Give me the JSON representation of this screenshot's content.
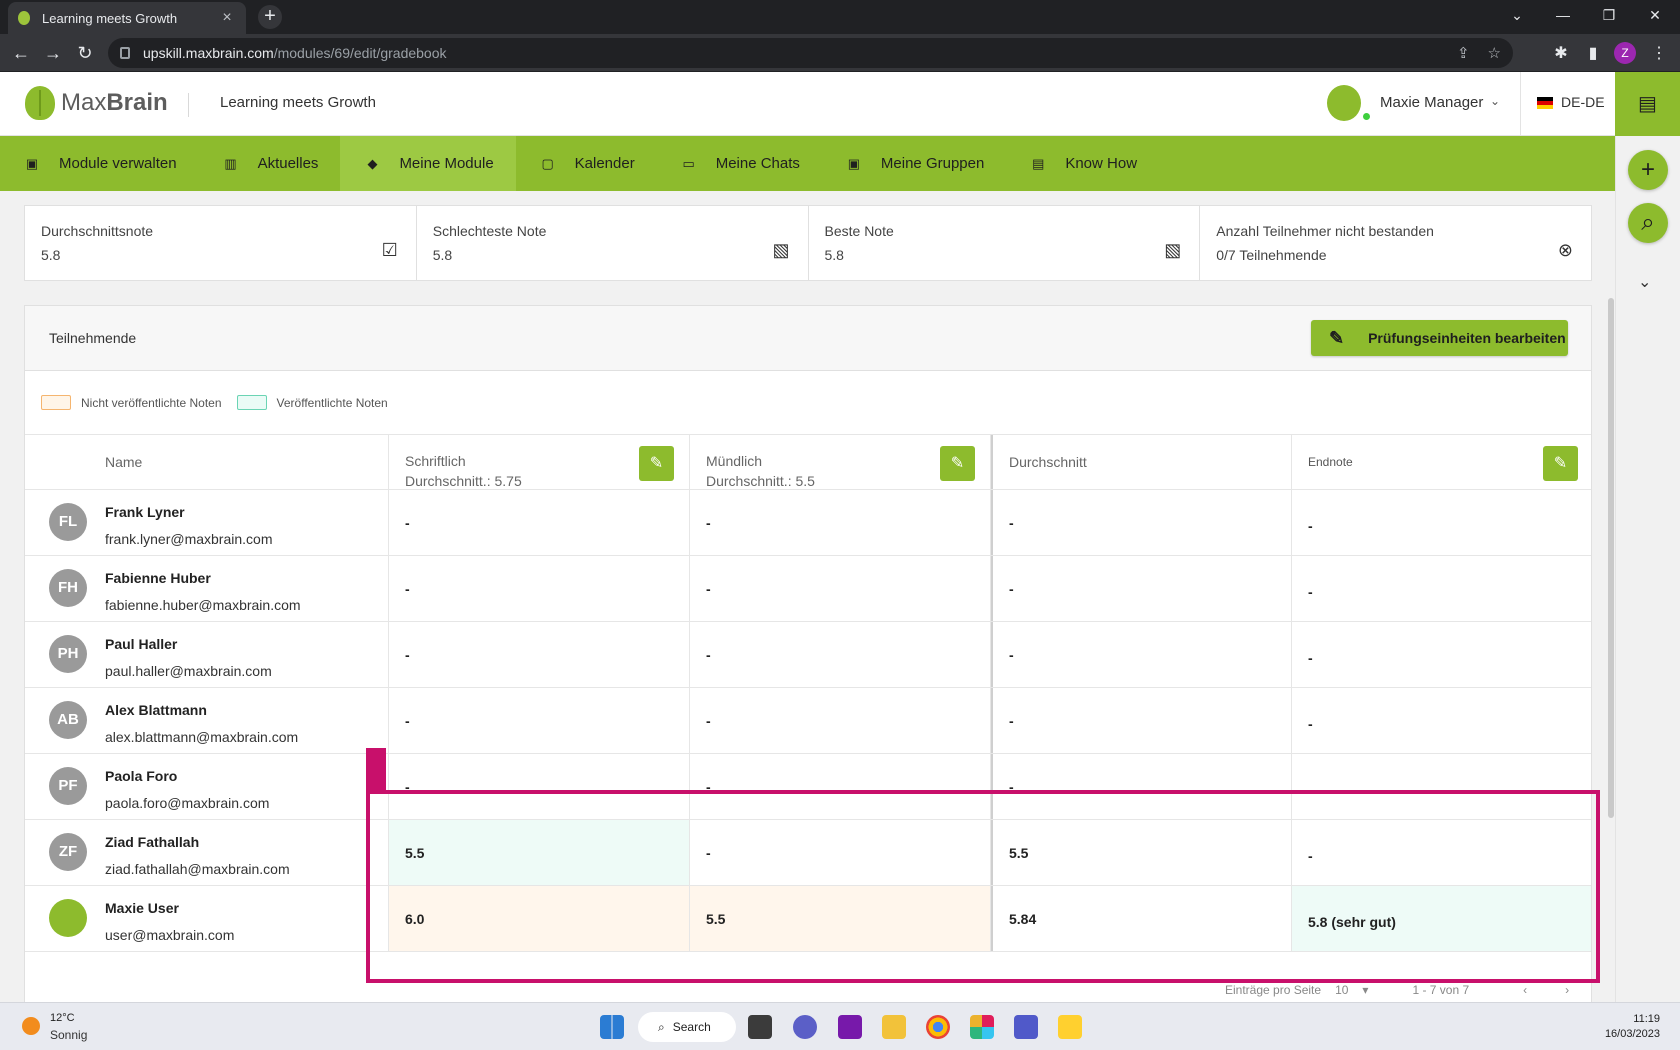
{
  "browser": {
    "tab_title": "Learning meets Growth",
    "url_host": "upskill.maxbrain.com",
    "url_path": "/modules/69/edit/gradebook",
    "profile_initial": "Z"
  },
  "header": {
    "logo_light": "Max",
    "logo_bold": "Brain",
    "tagline": "Learning meets Growth",
    "user_name": "Maxie Manager",
    "language": "DE-DE"
  },
  "nav": {
    "items": [
      {
        "label": "Module verwalten",
        "icon": "briefcase-icon"
      },
      {
        "label": "Aktuelles",
        "icon": "news-icon"
      },
      {
        "label": "Meine Module",
        "icon": "graduation-cap-icon"
      },
      {
        "label": "Kalender",
        "icon": "calendar-icon"
      },
      {
        "label": "Meine Chats",
        "icon": "chat-icon"
      },
      {
        "label": "Meine Gruppen",
        "icon": "group-icon"
      },
      {
        "label": "Know How",
        "icon": "book-icon"
      }
    ],
    "active_index": 2
  },
  "stats": [
    {
      "label": "Durchschnittsnote",
      "value": "5.8",
      "icon": "clipboard-check-icon"
    },
    {
      "label": "Schlechteste Note",
      "value": "5.8",
      "icon": "grade-file-icon"
    },
    {
      "label": "Beste Note",
      "value": "5.8",
      "icon": "grade-file-icon"
    },
    {
      "label": "Anzahl Teilnehmer nicht bestanden",
      "value": "0/7 Teilnehmende",
      "icon": "cap-cancel-icon"
    }
  ],
  "panel": {
    "title": "Teilnehmende",
    "edit_button": "Prüfungseinheiten bearbeiten",
    "legend_unpublished": "Nicht veröffentlichte Noten",
    "legend_published": "Veröffentlichte Noten"
  },
  "columns": {
    "name": "Name",
    "written": {
      "title": "Schriftlich",
      "avg": "Durchschnitt.: 5.75"
    },
    "oral": {
      "title": "Mündlich",
      "avg": "Durchschnitt.: 5.5"
    },
    "average": "Durchschnitt",
    "final": "Endnote"
  },
  "rows": [
    {
      "initials": "FL",
      "name": "Frank Lyner",
      "email": "frank.lyner@maxbrain.com",
      "written": "-",
      "oral": "-",
      "avg": "-",
      "final": "-"
    },
    {
      "initials": "FH",
      "name": "Fabienne Huber",
      "email": "fabienne.huber@maxbrain.com",
      "written": "-",
      "oral": "-",
      "avg": "-",
      "final": "-"
    },
    {
      "initials": "PH",
      "name": "Paul Haller",
      "email": "paul.haller@maxbrain.com",
      "written": "-",
      "oral": "-",
      "avg": "-",
      "final": "-"
    },
    {
      "initials": "AB",
      "name": "Alex Blattmann",
      "email": "alex.blattmann@maxbrain.com",
      "written": "-",
      "oral": "-",
      "avg": "-",
      "final": "-"
    },
    {
      "initials": "PF",
      "name": "Paola Foro",
      "email": "paola.foro@maxbrain.com",
      "written": "-",
      "oral": "-",
      "avg": "-",
      "final": ""
    },
    {
      "initials": "ZF",
      "name": "Ziad Fathallah",
      "email": "ziad.fathallah@maxbrain.com",
      "written": "5.5",
      "oral": "-",
      "avg": "5.5",
      "final": "-"
    },
    {
      "initials": "",
      "name": "Maxie User",
      "email": "user@maxbrain.com",
      "written": "6.0",
      "oral": "5.5",
      "avg": "5.84",
      "final": "5.8 (sehr gut)"
    }
  ],
  "pager": {
    "per_page_label": "Einträge pro Seite",
    "per_page": "10",
    "range": "1 - 7 von 7"
  },
  "taskbar": {
    "temperature": "12°C",
    "condition": "Sonnig",
    "search": "Search",
    "time": "11:19",
    "date": "16/03/2023"
  },
  "colors": {
    "brand_green": "#8dbb2d",
    "annotation": "#c8106b",
    "unpublished_bg": "#fff6ec",
    "published_bg": "#eefbf7"
  }
}
